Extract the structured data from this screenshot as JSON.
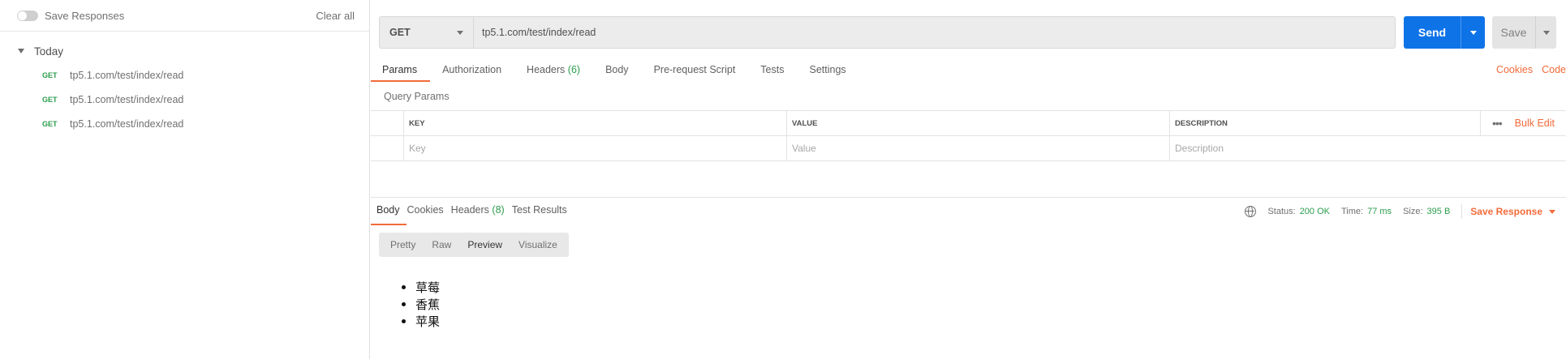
{
  "sidebar": {
    "save_responses_label": "Save Responses",
    "clear_all_label": "Clear all",
    "group_label": "Today",
    "history": [
      {
        "method": "GET",
        "url": "tp5.1.com/test/index/read"
      },
      {
        "method": "GET",
        "url": "tp5.1.com/test/index/read"
      },
      {
        "method": "GET",
        "url": "tp5.1.com/test/index/read"
      }
    ]
  },
  "request": {
    "method": "GET",
    "url": "tp5.1.com/test/index/read",
    "send_label": "Send",
    "save_label": "Save"
  },
  "request_tabs": {
    "params": "Params",
    "authorization": "Authorization",
    "headers": "Headers",
    "headers_count": "(6)",
    "body": "Body",
    "pre_request": "Pre-request Script",
    "tests": "Tests",
    "settings": "Settings",
    "cookies": "Cookies",
    "code": "Code"
  },
  "query_params": {
    "label": "Query Params",
    "columns": {
      "key": "KEY",
      "value": "VALUE",
      "description": "DESCRIPTION"
    },
    "placeholders": {
      "key": "Key",
      "value": "Value",
      "description": "Description"
    },
    "more": "•••",
    "bulk_edit": "Bulk Edit"
  },
  "response_tabs": {
    "body": "Body",
    "cookies": "Cookies",
    "headers": "Headers",
    "headers_count": "(8)",
    "test_results": "Test Results"
  },
  "response_status": {
    "status_label": "Status:",
    "status_value": "200 OK",
    "time_label": "Time:",
    "time_value": "77 ms",
    "size_label": "Size:",
    "size_value": "395 B",
    "save_response": "Save Response"
  },
  "view_modes": {
    "pretty": "Pretty",
    "raw": "Raw",
    "preview": "Preview",
    "visualize": "Visualize"
  },
  "preview_items": [
    "草莓",
    "香蕉",
    "苹果"
  ],
  "colors": {
    "accent": "#f26b3a",
    "send_blue": "#0f73e8",
    "success_green": "#2b9d4d"
  }
}
